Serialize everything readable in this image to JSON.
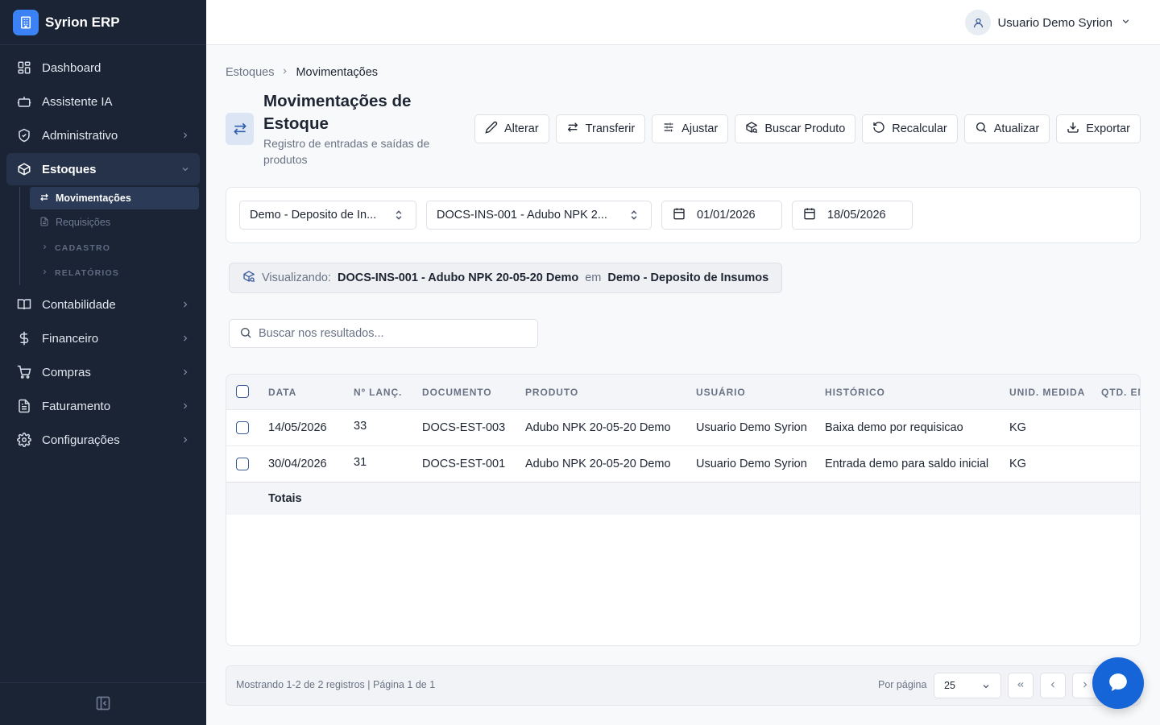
{
  "app": {
    "name": "Syrion ERP"
  },
  "sidebar": {
    "items": [
      {
        "label": "Dashboard",
        "icon": "dashboard-icon"
      },
      {
        "label": "Assistente IA",
        "icon": "bot-icon"
      },
      {
        "label": "Administrativo",
        "icon": "shield-icon"
      },
      {
        "label": "Estoques",
        "icon": "package-icon",
        "expanded": true
      },
      {
        "label": "Contabilidade",
        "icon": "book-icon"
      },
      {
        "label": "Financeiro",
        "icon": "dollar-icon"
      },
      {
        "label": "Compras",
        "icon": "cart-icon"
      },
      {
        "label": "Faturamento",
        "icon": "invoice-icon"
      },
      {
        "label": "Configurações",
        "icon": "gear-icon"
      }
    ],
    "estoques_sub": [
      {
        "label": "Movimentações",
        "active": true
      },
      {
        "label": "Requisições"
      }
    ],
    "estoques_groups": [
      "CADASTRO",
      "RELATÓRIOS"
    ]
  },
  "user": {
    "name": "Usuario Demo Syrion"
  },
  "breadcrumb": {
    "parent": "Estoques",
    "current": "Movimentações"
  },
  "page": {
    "title": "Movimentações de Estoque",
    "subtitle": "Registro de entradas e saídas de produtos"
  },
  "actions": [
    "Alterar",
    "Transferir",
    "Ajustar",
    "Buscar Produto",
    "Recalcular",
    "Atualizar",
    "Exportar"
  ],
  "filters": {
    "deposito": "Demo - Deposito de In...",
    "produto": "DOCS-INS-001 - Adubo NPK 2...",
    "date_from": "01/01/2026",
    "date_to": "18/05/2026"
  },
  "viewing": {
    "label": "Visualizando:",
    "product": "DOCS-INS-001 - Adubo NPK 20-05-20 Demo",
    "connector": "em",
    "deposit": "Demo - Deposito de Insumos"
  },
  "search": {
    "placeholder": "Buscar nos resultados..."
  },
  "table": {
    "columns": [
      "DATA",
      "Nº LANÇ.",
      "DOCUMENTO",
      "PRODUTO",
      "USUÁRIO",
      "HISTÓRICO",
      "UNID. MEDIDA",
      "QTD. EN"
    ],
    "rows": [
      {
        "data": "14/05/2026",
        "lanc": "33",
        "documento": "DOCS-EST-003",
        "produto": "Adubo NPK 20-05-20 Demo",
        "usuario": "Usuario Demo Syrion",
        "historico": "Baixa demo por requisicao",
        "unid": "KG"
      },
      {
        "data": "30/04/2026",
        "lanc": "31",
        "documento": "DOCS-EST-001",
        "produto": "Adubo NPK 20-05-20 Demo",
        "usuario": "Usuario Demo Syrion",
        "historico": "Entrada demo para saldo inicial",
        "unid": "KG"
      }
    ],
    "totals_label": "Totais"
  },
  "pagination": {
    "info": "Mostrando 1-2 de 2 registros | Página 1 de 1",
    "per_page_label": "Por página",
    "per_page": "25"
  },
  "colors": {
    "sidebar_bg": "#1b2435",
    "accent": "#3b82f6",
    "fab": "#1565d8"
  }
}
